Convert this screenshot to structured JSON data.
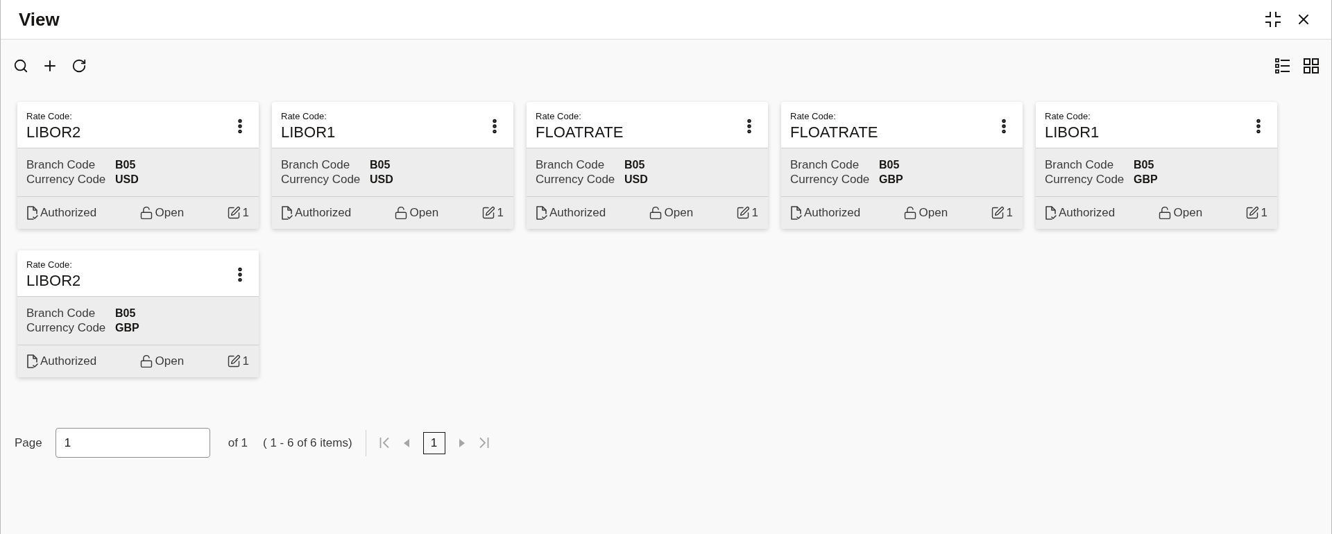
{
  "window": {
    "title": "View"
  },
  "cards": [
    {
      "label": "Rate Code:",
      "rate_code": "LIBOR2",
      "fields": [
        {
          "label": "Branch Code",
          "value": "B05"
        },
        {
          "label": "Currency Code",
          "value": "USD"
        }
      ],
      "status": "Authorized",
      "lock": "Open",
      "edits": "1"
    },
    {
      "label": "Rate Code:",
      "rate_code": "LIBOR1",
      "fields": [
        {
          "label": "Branch Code",
          "value": "B05"
        },
        {
          "label": "Currency Code",
          "value": "USD"
        }
      ],
      "status": "Authorized",
      "lock": "Open",
      "edits": "1"
    },
    {
      "label": "Rate Code:",
      "rate_code": "FLOATRATE",
      "fields": [
        {
          "label": "Branch Code",
          "value": "B05"
        },
        {
          "label": "Currency Code",
          "value": "USD"
        }
      ],
      "status": "Authorized",
      "lock": "Open",
      "edits": "1"
    },
    {
      "label": "Rate Code:",
      "rate_code": "FLOATRATE",
      "fields": [
        {
          "label": "Branch Code",
          "value": "B05"
        },
        {
          "label": "Currency Code",
          "value": "GBP"
        }
      ],
      "status": "Authorized",
      "lock": "Open",
      "edits": "1"
    },
    {
      "label": "Rate Code:",
      "rate_code": "LIBOR1",
      "fields": [
        {
          "label": "Branch Code",
          "value": "B05"
        },
        {
          "label": "Currency Code",
          "value": "GBP"
        }
      ],
      "status": "Authorized",
      "lock": "Open",
      "edits": "1"
    },
    {
      "label": "Rate Code:",
      "rate_code": "LIBOR2",
      "fields": [
        {
          "label": "Branch Code",
          "value": "B05"
        },
        {
          "label": "Currency Code",
          "value": "GBP"
        }
      ],
      "status": "Authorized",
      "lock": "Open",
      "edits": "1"
    }
  ],
  "pagination": {
    "label": "Page",
    "input": {
      "value": "1"
    },
    "total": "of 1",
    "range": "( 1 - 6 of 6 items)",
    "first": {
      "disabled": true
    },
    "previous": {
      "disabled": true
    },
    "pages": [
      {
        "label": "1",
        "selected": true
      }
    ],
    "next": {
      "disabled": true
    },
    "last": {
      "disabled": true
    }
  }
}
